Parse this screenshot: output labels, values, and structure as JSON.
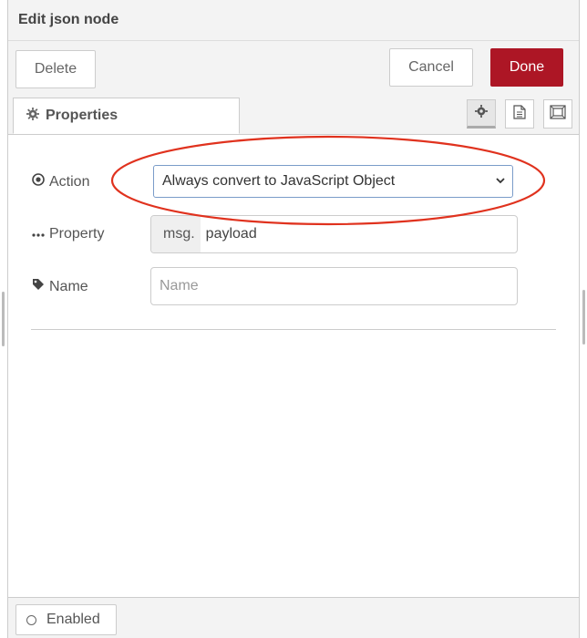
{
  "header": {
    "title": "Edit json node"
  },
  "toolbar": {
    "delete_label": "Delete",
    "cancel_label": "Cancel",
    "done_label": "Done"
  },
  "tabs": {
    "properties_label": "Properties",
    "icon_buttons": [
      "gear-icon",
      "document-icon",
      "frame-icon"
    ]
  },
  "form": {
    "action": {
      "label": "Action",
      "selected": "Always convert to JavaScript Object"
    },
    "property": {
      "label": "Property",
      "prefix": "msg.",
      "value": "payload"
    },
    "name": {
      "label": "Name",
      "placeholder": "Name",
      "value": ""
    }
  },
  "footer": {
    "enabled_label": "Enabled"
  },
  "colors": {
    "done_button": "#ad1625",
    "annotation_ellipse": "#e0321e"
  }
}
